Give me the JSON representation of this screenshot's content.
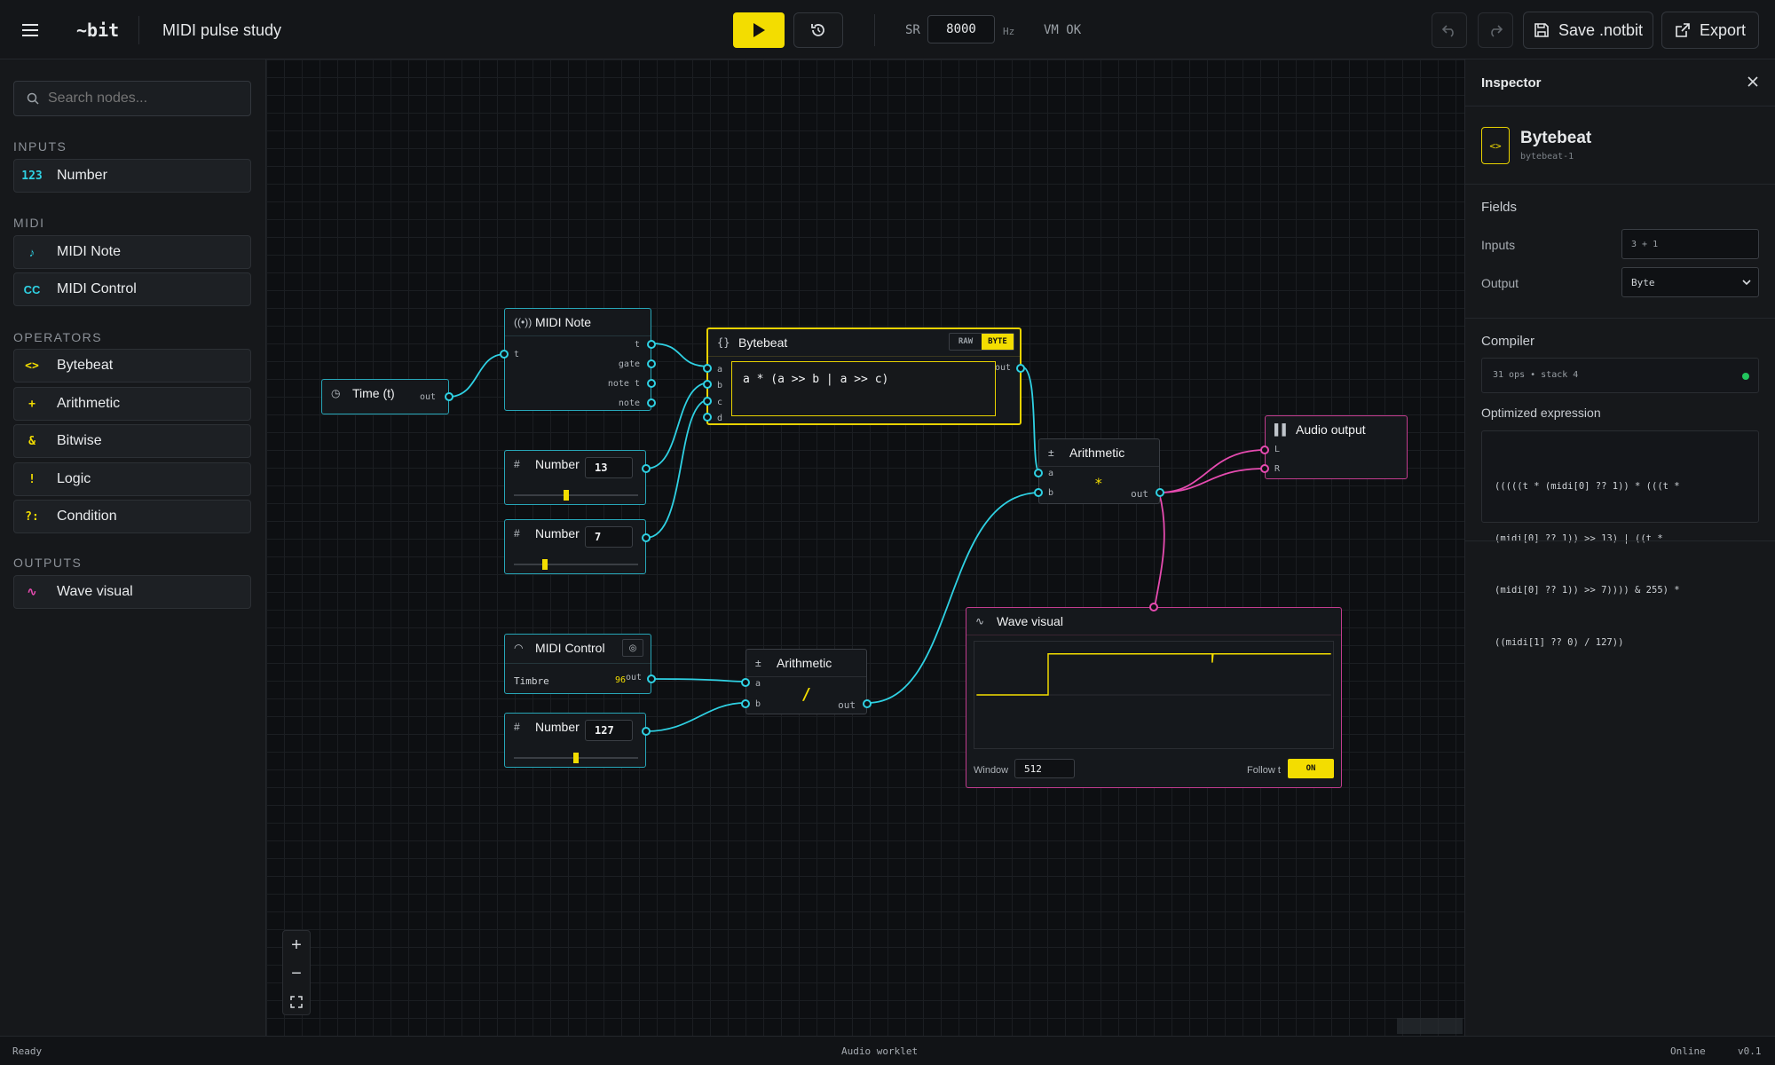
{
  "app": {
    "logo": "~bit",
    "title": "MIDI pulse study"
  },
  "toolbar": {
    "sr_label": "SR",
    "sr_value": "8000",
    "sr_unit": "Hz",
    "vm_status": "VM OK",
    "save_label": "Save .notbit",
    "export_label": "Export"
  },
  "search": {
    "placeholder": "Search nodes..."
  },
  "sidebar": {
    "sections": [
      {
        "title": "INPUTS",
        "items": [
          {
            "icon": "123",
            "label": "Number"
          }
        ]
      },
      {
        "title": "MIDI",
        "items": [
          {
            "icon": "♪",
            "label": "MIDI Note"
          },
          {
            "icon": "CC",
            "label": "MIDI Control"
          }
        ]
      },
      {
        "title": "OPERATORS",
        "items": [
          {
            "icon": "<>",
            "label": "Bytebeat"
          },
          {
            "icon": "+",
            "label": "Arithmetic"
          },
          {
            "icon": "&",
            "label": "Bitwise"
          },
          {
            "icon": "!",
            "label": "Logic"
          },
          {
            "icon": "?:",
            "label": "Condition"
          }
        ]
      },
      {
        "title": "OUTPUTS",
        "items": [
          {
            "icon": "∿",
            "label": "Wave visual"
          }
        ]
      }
    ]
  },
  "nodes": {
    "time": {
      "title": "Time (t)",
      "out": "out"
    },
    "midi_note": {
      "title": "MIDI Note",
      "in": "t",
      "outs": [
        "t",
        "gate",
        "note t",
        "note"
      ]
    },
    "bytebeat": {
      "title": "Bytebeat",
      "mode_raw": "RAW",
      "mode_byte": "BYTE",
      "expr": "a * (a >> b | a >> c)",
      "ins": [
        "a",
        "b",
        "c",
        "d"
      ],
      "out": "out"
    },
    "number1": {
      "title": "Number",
      "value": "13",
      "slider_fraction": 0.42
    },
    "number2": {
      "title": "Number",
      "value": "7",
      "slider_fraction": 0.24
    },
    "number3": {
      "title": "Number",
      "value": "127",
      "slider_fraction": 0.5
    },
    "arith1": {
      "title": "Arithmetic",
      "op": "*",
      "ins": [
        "a",
        "b"
      ],
      "out": "out"
    },
    "arith2": {
      "title": "Arithmetic",
      "op": "/",
      "ins": [
        "a",
        "b"
      ],
      "out": "out"
    },
    "audio_out": {
      "title": "Audio output",
      "ins": [
        "L",
        "R"
      ]
    },
    "midi_control": {
      "title": "MIDI Control",
      "param": "Timbre",
      "value": "96",
      "out": "out"
    },
    "wave": {
      "title": "Wave visual",
      "window_label": "Window",
      "window_value": "512",
      "follow_label": "Follow t",
      "follow_state": "ON"
    }
  },
  "inspector": {
    "title": "Inspector",
    "node_name": "Bytebeat",
    "node_id": "bytebeat-1",
    "fields_title": "Fields",
    "inputs_label": "Inputs",
    "inputs_value": "3 + 1",
    "output_label": "Output",
    "output_value": "Byte",
    "compiler_title": "Compiler",
    "compiler_stats": "31 ops • stack 4",
    "optimized_title": "Optimized expression",
    "optimized_lines": [
      "(((((t * (midi[0] ?? 1)) * (((t *",
      "(midi[0] ?? 1)) >> 13) | ((t *",
      "(midi[0] ?? 1)) >> 7)))) & 255) *",
      "((midi[1] ?? 0) / 127))"
    ]
  },
  "status": {
    "left": "Ready",
    "center": "Audio worklet",
    "online": "Online",
    "version": "v0.1"
  },
  "colors": {
    "accent": "#f3dd00",
    "wire": "#2fd1e3",
    "pink": "#e64bb0",
    "ok": "#22c55e"
  }
}
